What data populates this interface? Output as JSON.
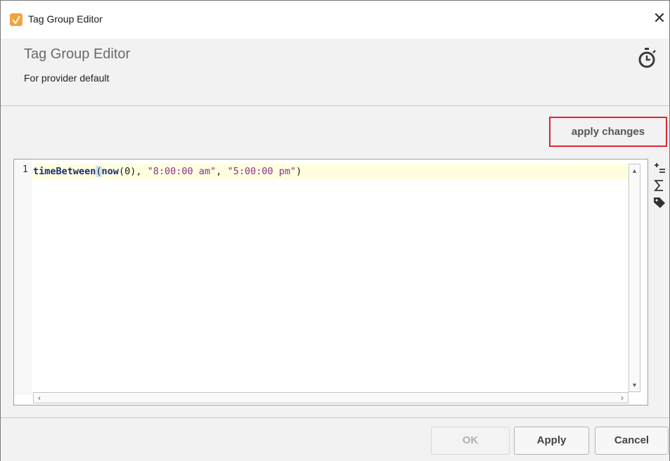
{
  "window": {
    "title": "Tag Group Editor",
    "close_symbol": "✕"
  },
  "header": {
    "title": "Tag Group Editor",
    "subtitle": "For provider default",
    "icon": "timer-icon"
  },
  "toolbar": {
    "apply_changes_label": "apply changes",
    "highlight_color": "#e0252f"
  },
  "editor": {
    "line_number": "1",
    "code": {
      "fn1": "timeBetween",
      "paren_open": "(",
      "fn2": "now",
      "arg_open": "(",
      "num": "0",
      "arg_close": ")",
      "sep1": ", ",
      "str1": "\"8:00:00 am\"",
      "sep2": ", ",
      "str2": "\"5:00:00 pm\"",
      "paren_close": ")"
    },
    "side_tools": [
      "insert-property-icon",
      "sigma-function-icon",
      "tag-icon"
    ]
  },
  "footer": {
    "ok_label": "OK",
    "apply_label": "Apply",
    "cancel_label": "Cancel"
  }
}
